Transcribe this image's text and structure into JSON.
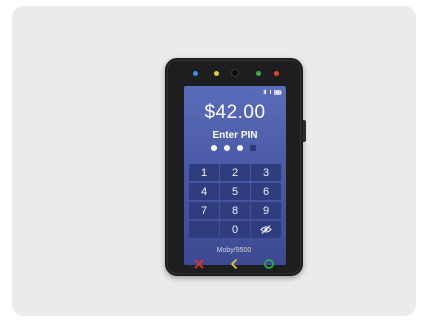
{
  "terminal": {
    "amount": "$42.00",
    "prompt": "Enter PIN",
    "pin": {
      "entered": 3,
      "length": 4
    },
    "model": "Moby/9500"
  },
  "keypad": {
    "keys": [
      "1",
      "2",
      "3",
      "4",
      "5",
      "6",
      "7",
      "8",
      "9",
      "",
      "0",
      ""
    ],
    "hide_pin_icon": "eye-slash-icon"
  },
  "status_icons": [
    "bluetooth-icon",
    "signal-icon",
    "battery-icon"
  ],
  "hardware_buttons": [
    {
      "name": "cancel",
      "icon": "x-icon",
      "color": "#e0342c"
    },
    {
      "name": "back",
      "icon": "chevron-left-icon",
      "color": "#e4c52a"
    },
    {
      "name": "ok",
      "icon": "circle-icon",
      "color": "#2ea94a"
    }
  ],
  "leds": [
    "#3a8ee6",
    "#d8d23a",
    "#38b04a",
    "#d8453a"
  ]
}
